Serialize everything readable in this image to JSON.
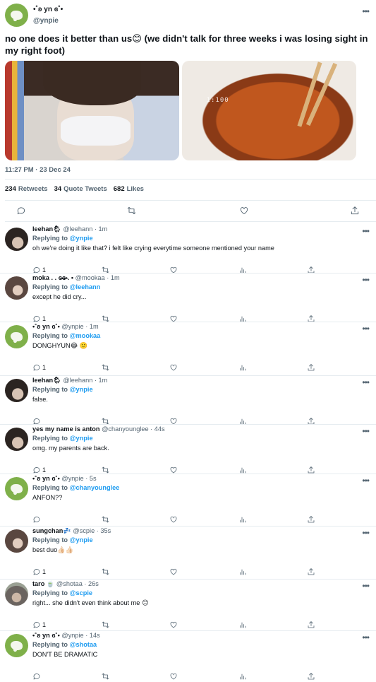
{
  "tweet": {
    "display_name": "•˚ʚ yn ɞ˚•",
    "username": "@ynpie",
    "text": "no one does it better than us😊 (we didn't talk for three weeks i was losing sight in my right foot)",
    "timer_text": "1:100",
    "timestamp": "11:27 PM · 23 Dec 24",
    "stats": {
      "retweets": "234",
      "retweets_label": "Retweets",
      "quotes": "34",
      "quotes_label": "Quote Tweets",
      "likes": "682",
      "likes_label": "Likes"
    }
  },
  "replies": [
    {
      "name": "leehan🌦",
      "handle": "@leehann",
      "time": "· 1m",
      "replying_label": "Replying to",
      "replying_to": "@ynpie",
      "text": "oh we're doing it like that? i felt like crying everytime someone mentioned your name",
      "reply_count": "1",
      "avatar": "dark"
    },
    {
      "name": "moka . . ɞ̶̷ɞ̶̷ . •",
      "handle": "@mookaa",
      "time": "· 1m",
      "replying_label": "Replying to",
      "replying_to": "@leehann",
      "text": "except he did cry...",
      "reply_count": "1",
      "avatar": "mid"
    },
    {
      "name": "•˚ʚ yn ɞ˚•",
      "handle": "@ynpie",
      "time": "· 1m",
      "replying_label": "Replying to",
      "replying_to": "@mookaa",
      "text": "DONGHYUN😂 🙂",
      "reply_count": "1",
      "avatar": "green"
    },
    {
      "name": "leehan🌦",
      "handle": "@leehann",
      "time": "· 1m",
      "replying_label": "Replying to",
      "replying_to": "@ynpie",
      "text": "false.",
      "reply_count": "",
      "avatar": "dark"
    },
    {
      "name": "yes my name is anton",
      "handle": "@chanyounglee",
      "time": "· 44s",
      "replying_label": "Replying to",
      "replying_to": "@ynpie",
      "text": "omg. my parents are back.",
      "reply_count": "1",
      "avatar": "dark"
    },
    {
      "name": "•˚ʚ yn ɞ˚•",
      "handle": "@ynpie",
      "time": "· 5s",
      "replying_label": "Replying to",
      "replying_to": "@chanyounglee",
      "text": "ANFON??",
      "reply_count": "",
      "avatar": "green"
    },
    {
      "name": "sungchan💤",
      "handle": "@scpie",
      "time": "· 35s",
      "replying_label": "Replying to",
      "replying_to": "@ynpie",
      "text": "best duo👍🏻👍🏻",
      "reply_count": "1",
      "avatar": "mid"
    },
    {
      "name": "taro 🍵",
      "handle": "@shotaa",
      "time": "· 26s",
      "replying_label": "Replying to",
      "replying_to": "@scpie",
      "text": "right... she didn't even think about me 😑",
      "reply_count": "1",
      "avatar": "hat"
    },
    {
      "name": "•˚ʚ yn ɞ˚•",
      "handle": "@ynpie",
      "time": "· 14s",
      "replying_label": "Replying to",
      "replying_to": "@shotaa",
      "text": "DON'T BE DRAMATIC",
      "reply_count": "",
      "avatar": "green"
    }
  ],
  "icons": [
    "reply-icon",
    "retweet-icon",
    "like-icon",
    "analytics-icon",
    "share-icon",
    "more-icon"
  ],
  "colors": {
    "accent": "#1d9bf0",
    "text": "#0f1419",
    "muted": "#536471",
    "divider": "#e6ecf0"
  }
}
